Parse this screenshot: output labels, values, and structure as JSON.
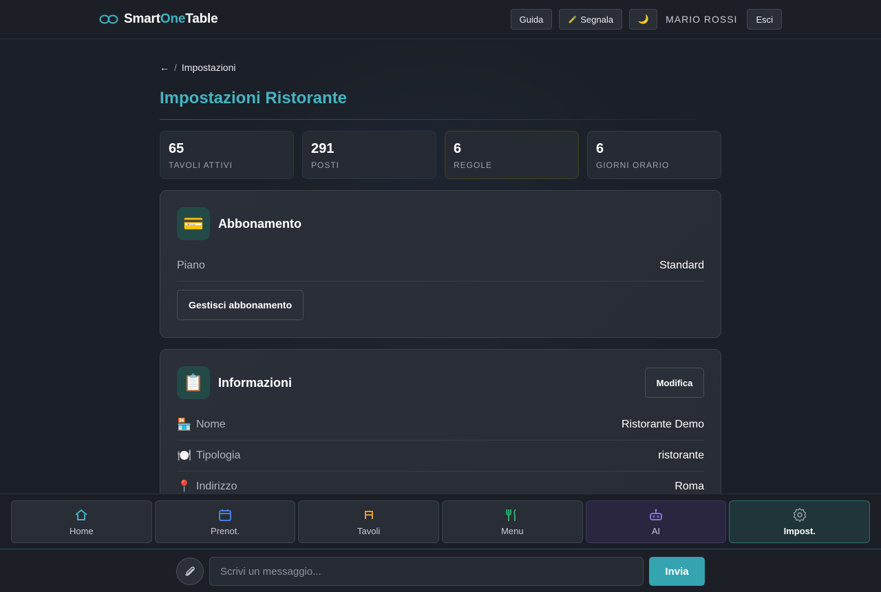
{
  "header": {
    "brand_prefix": "Smart",
    "brand_accent": "One",
    "brand_suffix": "Table",
    "guide_label": "Guida",
    "report_label": "Segnala",
    "theme_icon": "🌙",
    "user_name": "MARIO ROSSI",
    "logout_label": "Esci"
  },
  "breadcrumb": {
    "back": "←",
    "sep": "/",
    "current": "Impostazioni"
  },
  "page": {
    "title": "Impostazioni Ristorante"
  },
  "stats": [
    {
      "value": "65",
      "label": "TAVOLI ATTIVI"
    },
    {
      "value": "291",
      "label": "POSTI"
    },
    {
      "value": "6",
      "label": "REGOLE"
    },
    {
      "value": "6",
      "label": "GIORNI ORARIO"
    }
  ],
  "subscription": {
    "icon": "💳",
    "title": "Abbonamento",
    "plan_key": "Piano",
    "plan_value": "Standard",
    "manage_label": "Gestisci abbonamento"
  },
  "info": {
    "icon": "📋",
    "title": "Informazioni",
    "modify_label": "Modifica",
    "rows": [
      {
        "icon": "🏪",
        "key": "Nome",
        "value": "Ristorante Demo"
      },
      {
        "icon": "🍽️",
        "key": "Tipologia",
        "value": "ristorante"
      },
      {
        "icon": "📍",
        "key": "Indirizzo",
        "value": "Roma"
      }
    ]
  },
  "nav": [
    {
      "label": "Home"
    },
    {
      "label": "Prenot."
    },
    {
      "label": "Tavoli"
    },
    {
      "label": "Menu"
    },
    {
      "label": "AI"
    },
    {
      "label": "Impost."
    }
  ],
  "composer": {
    "placeholder": "Scrivi un messaggio...",
    "send_label": "Invia"
  },
  "colors": {
    "accent": "#3fb2c0",
    "send": "#35a4b0"
  }
}
